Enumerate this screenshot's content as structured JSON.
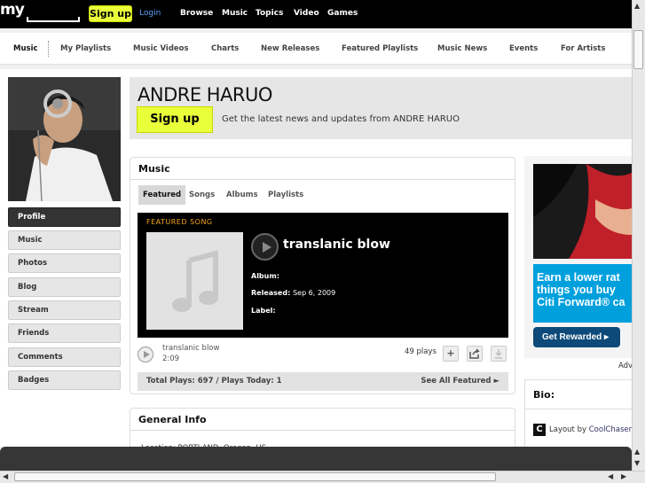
{
  "topbar": {
    "logo_text": "my",
    "signup_label": "Sign up",
    "login_label": "Login",
    "nav": [
      "Browse",
      "Music",
      "Topics",
      "Video",
      "Games"
    ]
  },
  "subnav": [
    "Music",
    "My Playlists",
    "Music Videos",
    "Charts",
    "New Releases",
    "Featured Playlists",
    "Music News",
    "Events",
    "For Artists"
  ],
  "sidebar": [
    "Profile",
    "Music",
    "Photos",
    "Blog",
    "Stream",
    "Friends",
    "Comments",
    "Badges"
  ],
  "header": {
    "artist_name": "ANDRE HARUO",
    "signup_label": "Sign up",
    "tagline": "Get the latest news and updates from ANDRE HARUO"
  },
  "music": {
    "title": "Music",
    "tabs": [
      "Featured",
      "Songs",
      "Albums",
      "Playlists"
    ],
    "featured_label": "FEATURED SONG",
    "song_title": "translanic blow",
    "album_label": "Album:",
    "released_label": "Released:",
    "released_value": "Sep 6, 2009",
    "label_label": "Label:",
    "track_name": "translanic blow",
    "track_length": "2:09",
    "plays": "49 plays",
    "totals": "Total Plays: 697 / Plays Today: 1",
    "see_all": "See All Featured ►"
  },
  "general": {
    "title": "General Info",
    "location": "Location: PORTLAND, Oregon, US"
  },
  "ad": {
    "text_line1": "Earn a lower rat",
    "text_line2": "things you buy",
    "text_line3": "Citi Forward® ca",
    "button": "Get Rewarded ▸",
    "label": "Adv"
  },
  "bio": {
    "title": "Bio:",
    "layout_prefix": "Layout by",
    "layout_author": "CoolChaser"
  },
  "colors": {
    "accent": "#e9ff3a",
    "featured_label": "#f7a31b",
    "ad_blue": "#00a0dd"
  }
}
